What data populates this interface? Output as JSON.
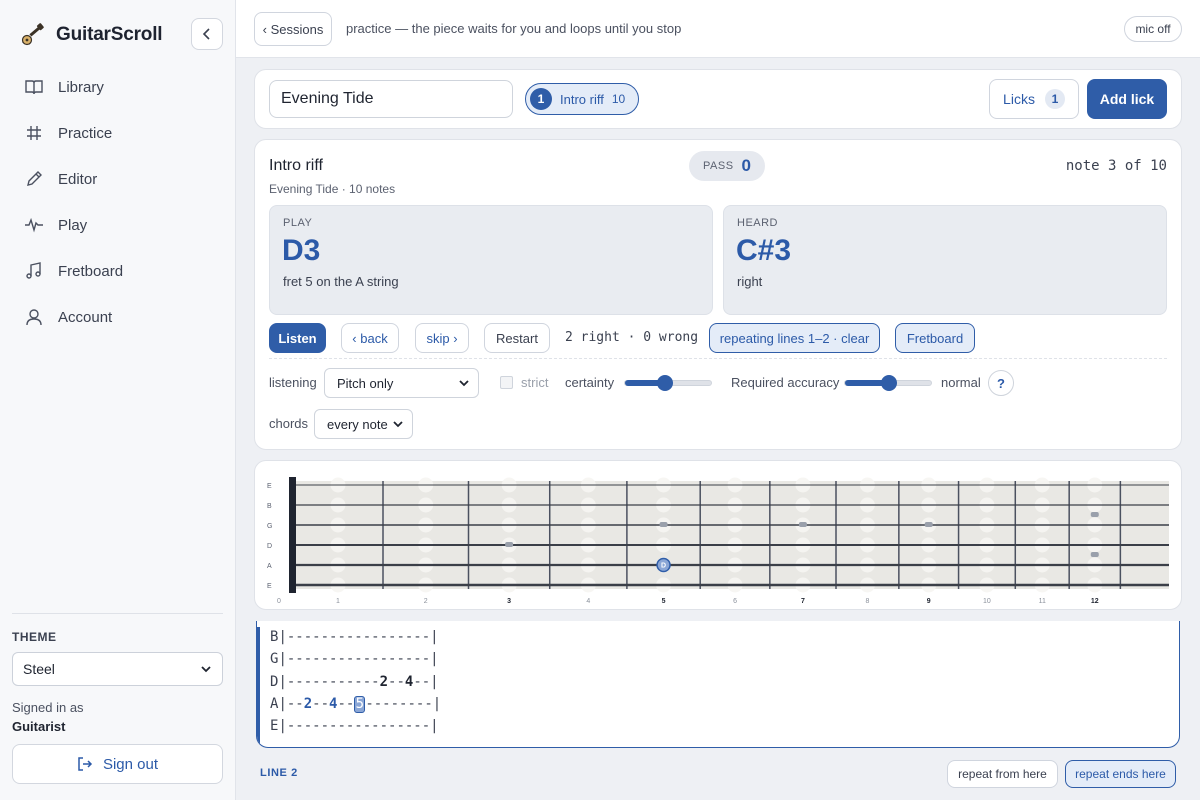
{
  "app": {
    "name": "GuitarScroll"
  },
  "nav": [
    {
      "label": "Library",
      "icon": "book-icon"
    },
    {
      "label": "Practice",
      "icon": "hash-icon"
    },
    {
      "label": "Editor",
      "icon": "pencil-icon"
    },
    {
      "label": "Play",
      "icon": "pulse-icon"
    },
    {
      "label": "Fretboard",
      "icon": "music-note-icon"
    },
    {
      "label": "Account",
      "icon": "user-icon"
    }
  ],
  "theme": {
    "label": "THEME",
    "value": "Steel"
  },
  "user": {
    "signed_in_label": "Signed in as",
    "name": "Guitarist",
    "signout_label": "Sign out"
  },
  "topbar": {
    "back_label": "‹ Sessions",
    "message": "practice — the piece waits for you and loops until you stop",
    "mic_label": "mic off"
  },
  "piece": {
    "title": "Evening Tide",
    "riff": {
      "number": "1",
      "name": "Intro riff",
      "count": "10"
    },
    "licks_label": "Licks",
    "licks_count": "1",
    "add_lick_label": "Add lick"
  },
  "practice": {
    "title": "Intro riff",
    "subtitle": "Evening Tide · 10 notes",
    "pass_label": "PASS",
    "pass_value": "0",
    "note_position": "note 3 of 10",
    "play": {
      "label": "PLAY",
      "note": "D3",
      "detail": "fret 5 on the A string"
    },
    "heard": {
      "label": "HEARD",
      "note": "C#3",
      "detail": "right"
    },
    "buttons": {
      "listen": "Listen",
      "back": "‹ back",
      "skip": "skip ›",
      "restart": "Restart",
      "repeating": "repeating lines 1–2 · clear",
      "fretboard": "Fretboard"
    },
    "score": "2 right · 0 wrong",
    "listening_label": "listening",
    "listening_value": "Pitch only",
    "strict_label": "strict",
    "certainty_label": "certainty",
    "certainty_value": 0.45,
    "accuracy_label": "Required accuracy",
    "accuracy_value": 0.5,
    "accuracy_mode": "normal",
    "help_label": "?",
    "chords_label": "chords",
    "chords_value": "every note"
  },
  "fretboard": {
    "strings": [
      "E",
      "B",
      "G",
      "D",
      "A",
      "E"
    ],
    "fret_numbers": [
      "0",
      "1",
      "2",
      "3",
      "4",
      "5",
      "6",
      "7",
      "8",
      "9",
      "10",
      "11",
      "12"
    ],
    "bold_frets": [
      "3",
      "5",
      "7",
      "9",
      "12"
    ],
    "active_note": {
      "string": "A",
      "fret": 5,
      "label": "D"
    },
    "colors": {
      "accent": "#2f5da8",
      "board": "#e9e8e4"
    }
  },
  "tab": {
    "lines": [
      {
        "string": "B",
        "text": "|-----------------|"
      },
      {
        "string": "G",
        "text": "|-----------------|"
      },
      {
        "string": "D",
        "pre": "|-----------",
        "n1": "2",
        "mid": "--",
        "n2": "4",
        "post": "--|"
      },
      {
        "string": "A",
        "pre": "|--",
        "n1": "2",
        "mid": "--",
        "n2": "4",
        "mid2": "--",
        "cur": "5",
        "post": "--------|"
      },
      {
        "string": "E",
        "text": "|-----------------|"
      }
    ],
    "line_label": "LINE 2",
    "repeat_from_label": "repeat from here",
    "repeat_ends_label": "repeat ends here"
  }
}
